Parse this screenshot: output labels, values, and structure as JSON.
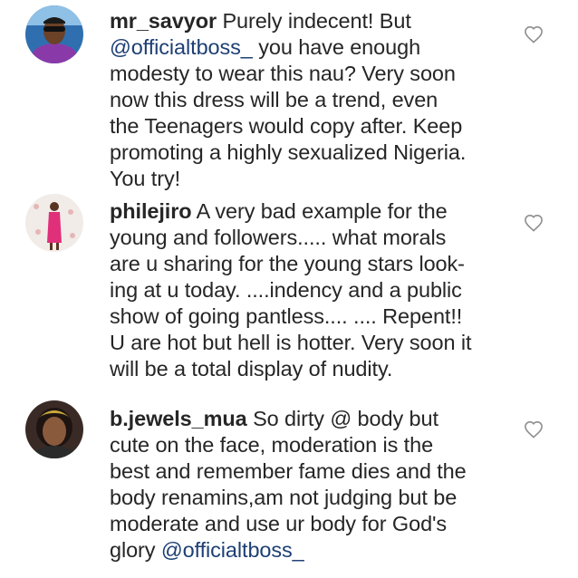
{
  "comments": [
    {
      "username": "mr_savyor",
      "lines": [
        "Purely indecent! But",
        "@officialtboss_",
        " you have enough",
        "modesty to wear this nau? Very soon",
        "now this dress will be a trend, even",
        "the Teenagers would copy after.  Keep",
        "promoting a highly sexualized Nigeria.",
        "You try!"
      ],
      "avatar_icon": "user-avatar-sunglasses"
    },
    {
      "username": "philejiro",
      "lines": [
        "A very bad example for the",
        "young and followers..... what morals",
        "are u sharing for the young stars look-",
        "ing at u today. ....indency and a public",
        "show of going pantless.... .... Repent!!",
        "U are hot but hell is hotter.  Very soon it",
        "will be a total display of nudity."
      ],
      "avatar_icon": "user-avatar-pink-dress"
    },
    {
      "username": "b.jewels_mua",
      "lines": [
        "So dirty @  body but",
        "cute on the face, moderation is the",
        "best and remember fame dies and the",
        "body renamins,am not judging but be",
        "moderate and use ur body for God's",
        "glory ",
        "@officialtboss_"
      ],
      "avatar_icon": "user-avatar-woman"
    }
  ],
  "icons": {
    "like": "heart-outline-icon"
  },
  "colors": {
    "text": "#262626",
    "mention": "#1d3f74",
    "icon": "#8e8e8e"
  }
}
